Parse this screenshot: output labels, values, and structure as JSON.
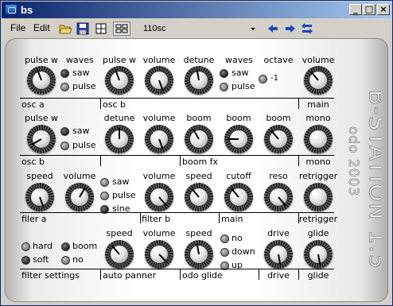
{
  "window": {
    "title": "bs"
  },
  "menu": {
    "file": "File",
    "edit": "Edit"
  },
  "toolbar": {
    "preset": "110sc"
  },
  "brand": {
    "name": "B-STATION 1.5",
    "sub": "odo 2003"
  },
  "knobs": {
    "k1": {
      "label": "pulse w",
      "angle": -20
    },
    "k2": {
      "label": "pulse w",
      "angle": -20
    },
    "k3": {
      "label": "volume",
      "angle": 160
    },
    "k4": {
      "label": "detune",
      "angle": -10
    },
    "k5": {
      "label": "volume",
      "angle": -40
    },
    "k6": {
      "label": "pulse w",
      "angle": -120
    },
    "k7": {
      "label": "detune",
      "angle": 0
    },
    "k8": {
      "label": "volume",
      "angle": 160
    },
    "k9": {
      "label": "boom",
      "angle": -30
    },
    "k10": {
      "label": "boom",
      "angle": -90
    },
    "k11": {
      "label": "boom",
      "angle": -40
    },
    "k12": {
      "label": "speed",
      "angle": 160
    },
    "k13": {
      "label": "volume",
      "angle": 30
    },
    "k14": {
      "label": "volume",
      "angle": 140
    },
    "k15": {
      "label": "speed",
      "angle": -40
    },
    "k16": {
      "label": "cutoff",
      "angle": -40
    },
    "k17": {
      "label": "reso",
      "angle": 140
    },
    "k18": {
      "label": "speed",
      "angle": -40
    },
    "k19": {
      "label": "volume",
      "angle": 135
    },
    "k20": {
      "label": "speed",
      "angle": -10
    },
    "k21": {
      "label": "drive",
      "angle": 170
    },
    "k22": {
      "label": "glide",
      "angle": 170
    }
  },
  "labels": {
    "waves": "waves",
    "octave": "octave",
    "volume_main": "volume",
    "mono": "mono",
    "retrigger": "retrigger",
    "glide": "glide"
  },
  "options": {
    "saw": "saw",
    "pulse": "pulse",
    "sine": "sine",
    "minus1": "-1",
    "hard": "hard",
    "soft": "soft",
    "boom": "boom",
    "no": "no",
    "down": "down",
    "up": "up"
  },
  "sections": {
    "osc_a": "osc a",
    "osc_b1": "osc b",
    "main1": "main",
    "osc_b2": "osc b",
    "boom_fx": "boom fx",
    "mono": "mono",
    "filer_a": "filer a",
    "filter_b": "filter b",
    "main2": "main",
    "retrigger": "retrigger",
    "filter_settings": "filter settings",
    "auto_panner": "auto panner",
    "odo_glide": "odo glide",
    "drive": "drive",
    "glide": "glide"
  }
}
